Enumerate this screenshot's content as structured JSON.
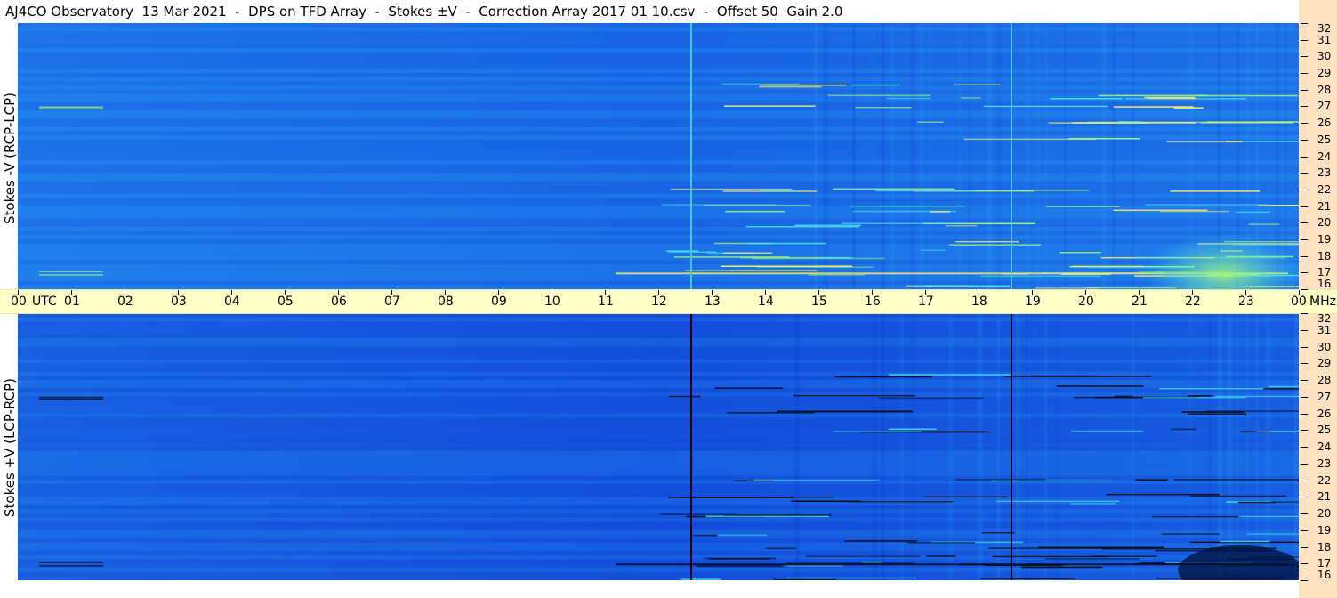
{
  "header": {
    "title": "AJ4CO Observatory  13 Mar 2021  -  DPS on TFD Array  -  Stokes ±V  -  Correction Array 2017 01 10.csv  -  Offset 50  Gain 2.0"
  },
  "chart_data": [
    {
      "type": "heatmap",
      "title": "",
      "ylabel": "Stokes -V (RCP-LCP)",
      "xlabel": "",
      "x_unit": "UTC",
      "y_unit": "MHz",
      "x_ticks": [
        "00",
        "01",
        "02",
        "03",
        "04",
        "05",
        "06",
        "07",
        "08",
        "09",
        "10",
        "11",
        "12",
        "13",
        "14",
        "15",
        "16",
        "17",
        "18",
        "19",
        "20",
        "21",
        "22",
        "23",
        "00"
      ],
      "y_ticks": [
        "16",
        "17",
        "18",
        "19",
        "20",
        "21",
        "22",
        "23",
        "24",
        "25",
        "26",
        "27",
        "28",
        "29",
        "30",
        "31",
        "32"
      ],
      "xlim": [
        0,
        24
      ],
      "ylim": [
        16,
        32
      ],
      "colormap": [
        "#0b2fd1",
        "#1663e6",
        "#27a2f6",
        "#48dfe8",
        "#a0f47a",
        "#f6f06a",
        "#ff4b28"
      ],
      "vertical_lines_utc": [
        12.6,
        18.6
      ],
      "vertical_line_color": "#47c8e0"
    },
    {
      "type": "heatmap",
      "title": "",
      "ylabel": "Stokes +V (LCP-RCP)",
      "xlabel": "",
      "x_unit": "UTC",
      "y_unit": "MHz",
      "x_ticks": [
        "00",
        "01",
        "02",
        "03",
        "04",
        "05",
        "06",
        "07",
        "08",
        "09",
        "10",
        "11",
        "12",
        "13",
        "14",
        "15",
        "16",
        "17",
        "18",
        "19",
        "20",
        "21",
        "22",
        "23",
        "00"
      ],
      "y_ticks": [
        "16",
        "17",
        "18",
        "19",
        "20",
        "21",
        "22",
        "23",
        "24",
        "25",
        "26",
        "27",
        "28",
        "29",
        "30",
        "31",
        "32"
      ],
      "xlim": [
        0,
        24
      ],
      "ylim": [
        16,
        32
      ],
      "colormap": [
        "#0b2fd1",
        "#1663e6",
        "#27a2f6",
        "#48dfe8",
        "#a0f47a",
        "#f6f06a",
        "#ff4b28"
      ],
      "vertical_lines_utc": [
        12.6,
        18.6
      ],
      "vertical_line_color": "#000000"
    }
  ]
}
